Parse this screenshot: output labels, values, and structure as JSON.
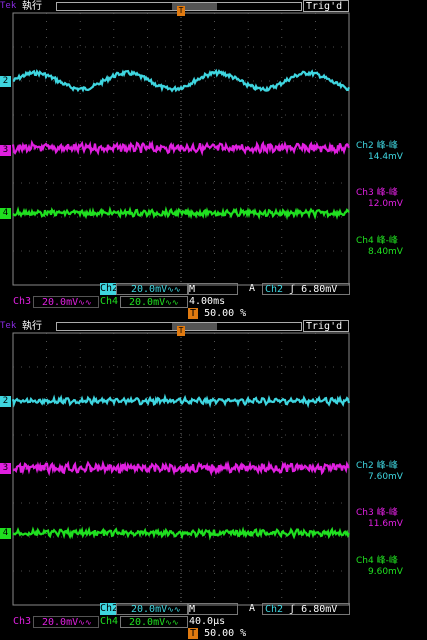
{
  "colors": {
    "ch2": "#3fd6e0",
    "ch3": "#e020e0",
    "ch4": "#20e020",
    "trig": "#e07a10",
    "brand": "#8a2be2"
  },
  "panels": [
    {
      "brand": "Tek",
      "state": "執行",
      "trig_status": "Trig'd",
      "markers": {
        "ch2": "2",
        "ch3": "3",
        "ch4": "4",
        "trigger": "T"
      },
      "measurements": [
        {
          "label": "Ch2 峰-峰",
          "value": "14.4mV",
          "channel": "ch2"
        },
        {
          "label": "Ch3 峰-峰",
          "value": "12.0mV",
          "channel": "ch3"
        },
        {
          "label": "Ch4 峰-峰",
          "value": "8.40mV",
          "channel": "ch4"
        }
      ],
      "ch2_label": "Ch2",
      "ch2_scale": "20.0mV",
      "ch2_coupling": "∿∿",
      "timebase": "M 4.00ms",
      "trigger_source_label": "A",
      "trigger_ch": "Ch2",
      "trigger_slope": "ʃ",
      "trigger_level": "6.80mV",
      "ch3_label": "Ch3",
      "ch3_scale": "20.0mV",
      "ch3_coupling": "∿∿",
      "ch4_label": "Ch4",
      "ch4_scale": "20.0mV",
      "ch4_coupling": "∿∿",
      "trigger_position": "50.00 %"
    },
    {
      "brand": "Tek",
      "state": "執行",
      "trig_status": "Trig'd",
      "markers": {
        "ch2": "2",
        "ch3": "3",
        "ch4": "4",
        "trigger": "T"
      },
      "measurements": [
        {
          "label": "Ch2 峰-峰",
          "value": "7.60mV",
          "channel": "ch2"
        },
        {
          "label": "Ch3 峰-峰",
          "value": "11.6mV",
          "channel": "ch3"
        },
        {
          "label": "Ch4 峰-峰",
          "value": "9.60mV",
          "channel": "ch4"
        }
      ],
      "ch2_label": "Ch2",
      "ch2_scale": "20.0mV",
      "ch2_coupling": "∿∿",
      "timebase": "M 40.0µs",
      "trigger_source_label": "A",
      "trigger_ch": "Ch2",
      "trigger_slope": "ʃ",
      "trigger_level": "6.80mV",
      "ch3_label": "Ch3",
      "ch3_scale": "20.0mV",
      "ch3_coupling": "∿∿",
      "ch4_label": "Ch4",
      "ch4_scale": "20.0mV",
      "ch4_coupling": "∿∿",
      "trigger_position": "50.00 %"
    }
  ]
}
